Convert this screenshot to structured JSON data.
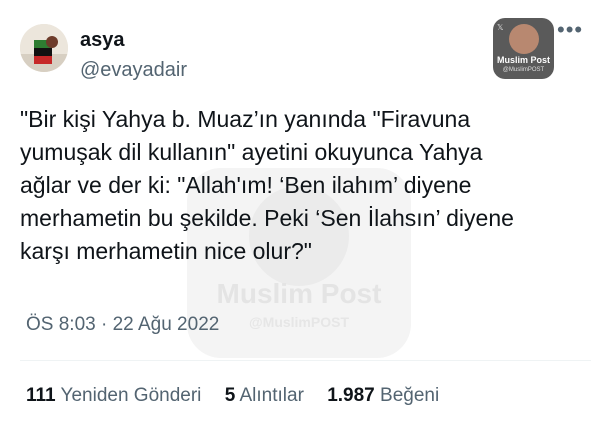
{
  "user": {
    "name": "asya",
    "handle": "@evayadair"
  },
  "badge": {
    "title": "Muslim Post",
    "subtitle": "@MuslimPOST"
  },
  "watermark": {
    "title": "Muslim Post",
    "subtitle": "@MuslimPOST"
  },
  "tweet": {
    "lines": [
      "\"Bir kişi Yahya b. Muaz’ın yanında \"Firavuna",
      "yumuşak dil kullanın\" ayetini okuyunca Yahya",
      "ağlar ve der ki: \"Allah'ım! ‘Ben ilahım’ diyene",
      "merhametin bu şekilde. Peki ‘Sen İlahsın’ diyene",
      "karşı merhametin nice olur?\""
    ],
    "time": "ÖS 8:03",
    "separator": "·",
    "date": "22 Ağu 2022"
  },
  "stats": {
    "retweets_count": "111",
    "retweets_label": "Yeniden Gönderi",
    "quotes_count": "5",
    "quotes_label": "Alıntılar",
    "likes_count": "1.987",
    "likes_label": "Beğeni"
  },
  "colors": {
    "text": "#0f1419",
    "secondary": "#536471",
    "divider": "#eff3f4"
  }
}
